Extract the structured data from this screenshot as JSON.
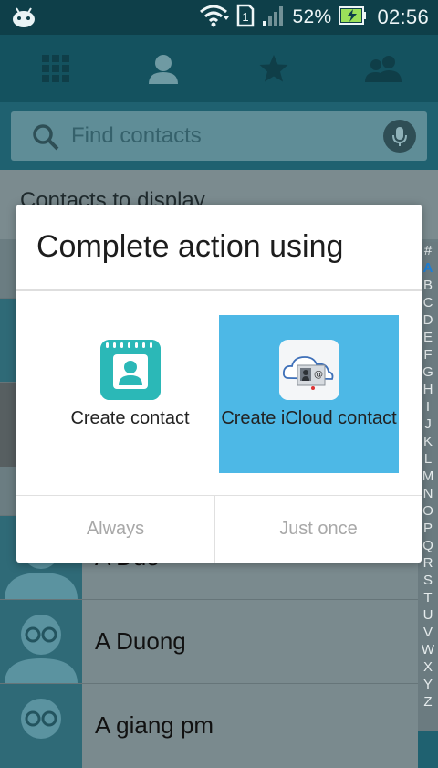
{
  "status_bar": {
    "battery_percent": "52%",
    "time": "02:56",
    "sim_slot": "1",
    "icons": [
      "android-notification-icon",
      "wifi-icon",
      "sim-icon",
      "signal-icon",
      "battery-charging-icon"
    ]
  },
  "toolbar": {
    "tabs": [
      "dialpad-grid-icon",
      "contact-person-icon",
      "favorites-star-icon",
      "groups-icon"
    ]
  },
  "search": {
    "placeholder": "Find contacts"
  },
  "contacts_bar": {
    "label": "Contacts to display"
  },
  "contacts": [
    {
      "name": ""
    },
    {
      "name": ""
    },
    {
      "name": "A Duo"
    },
    {
      "name": "A Duong"
    },
    {
      "name": "A giang pm"
    }
  ],
  "index_letters": [
    "#",
    "A",
    "B",
    "C",
    "D",
    "E",
    "F",
    "G",
    "H",
    "I",
    "J",
    "K",
    "L",
    "M",
    "N",
    "O",
    "P",
    "Q",
    "R",
    "S",
    "T",
    "U",
    "V",
    "W",
    "X",
    "Y",
    "Z"
  ],
  "dialog": {
    "title": "Complete action using",
    "options": [
      {
        "label": "Create contact",
        "icon": "contacts-app-icon",
        "selected": false
      },
      {
        "label": "Create iCloud contact",
        "icon": "icloud-contact-icon",
        "selected": true
      }
    ],
    "buttons": {
      "always": "Always",
      "just_once": "Just once"
    }
  },
  "colors": {
    "status_bar": "#0e3f49",
    "toolbar": "#14525f",
    "selected_option": "#4db8e6"
  }
}
